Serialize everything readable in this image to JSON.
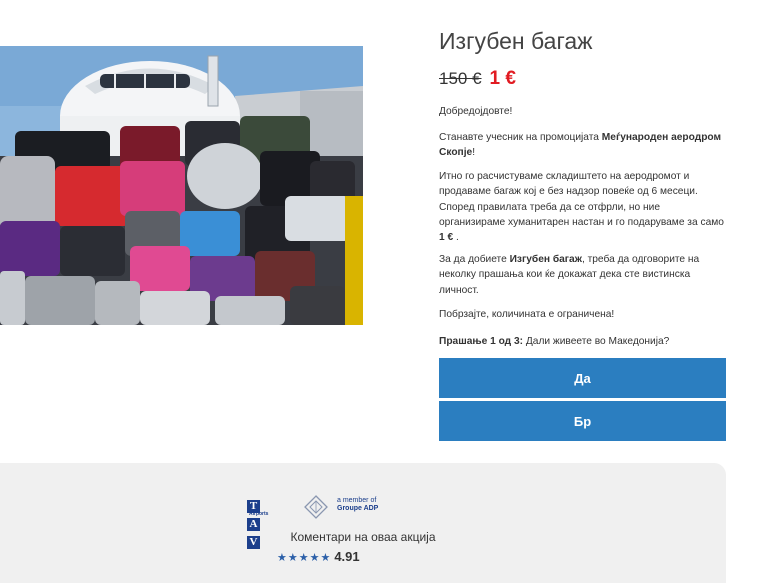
{
  "product": {
    "title": "Изгубен багаж",
    "old_price": "150 €",
    "new_price": "1 €"
  },
  "content": {
    "greeting": "Добредојдовте!",
    "promo_prefix": "Станавте учесник на промоцијата ",
    "promo_bold": "Меѓународен аеродром Скопје",
    "promo_suffix": "!",
    "info_text": "Итно го расчистуваме складиштето на аеродромот и продаваме багаж кој е без надзор повеќе од 6 месеци. Според правилата треба да се отфрли, но ние организираме хуманитарен настан и го подаруваме за само ",
    "info_bold": "1 €",
    "info_suffix": " .",
    "get_prefix": "За да добиете ",
    "get_bold": "Изгубен багаж",
    "get_suffix": ", треба да одговорите на неколку прашања кои ќе докажат дека сте вистинска личност.",
    "hurry": "Побрзајте, количината е ограничена!",
    "question_label": "Прашање 1 од 3:",
    "question_text": " Дали живеете во Македонија?"
  },
  "buttons": {
    "yes": "Да",
    "no": "Бр"
  },
  "footer": {
    "tav_letters": [
      "T",
      "A",
      "V"
    ],
    "tav_sub": "Airports",
    "adp_line1": "a member of",
    "adp_line2": "Groupe ADP",
    "comments_label": "Коментари на оваа акција",
    "stars": "★★★★★",
    "rating": "4.91"
  },
  "colors": {
    "accent_button": "#2b7ec0",
    "sale_price": "#e11b22",
    "footer_bg": "#f0f0f0",
    "brand_blue": "#1c3f8c"
  },
  "icons": {
    "photo": "airplane-with-luggage-pile-photo",
    "adp": "adp-diamond-logo-icon",
    "rating": "star-icon"
  }
}
